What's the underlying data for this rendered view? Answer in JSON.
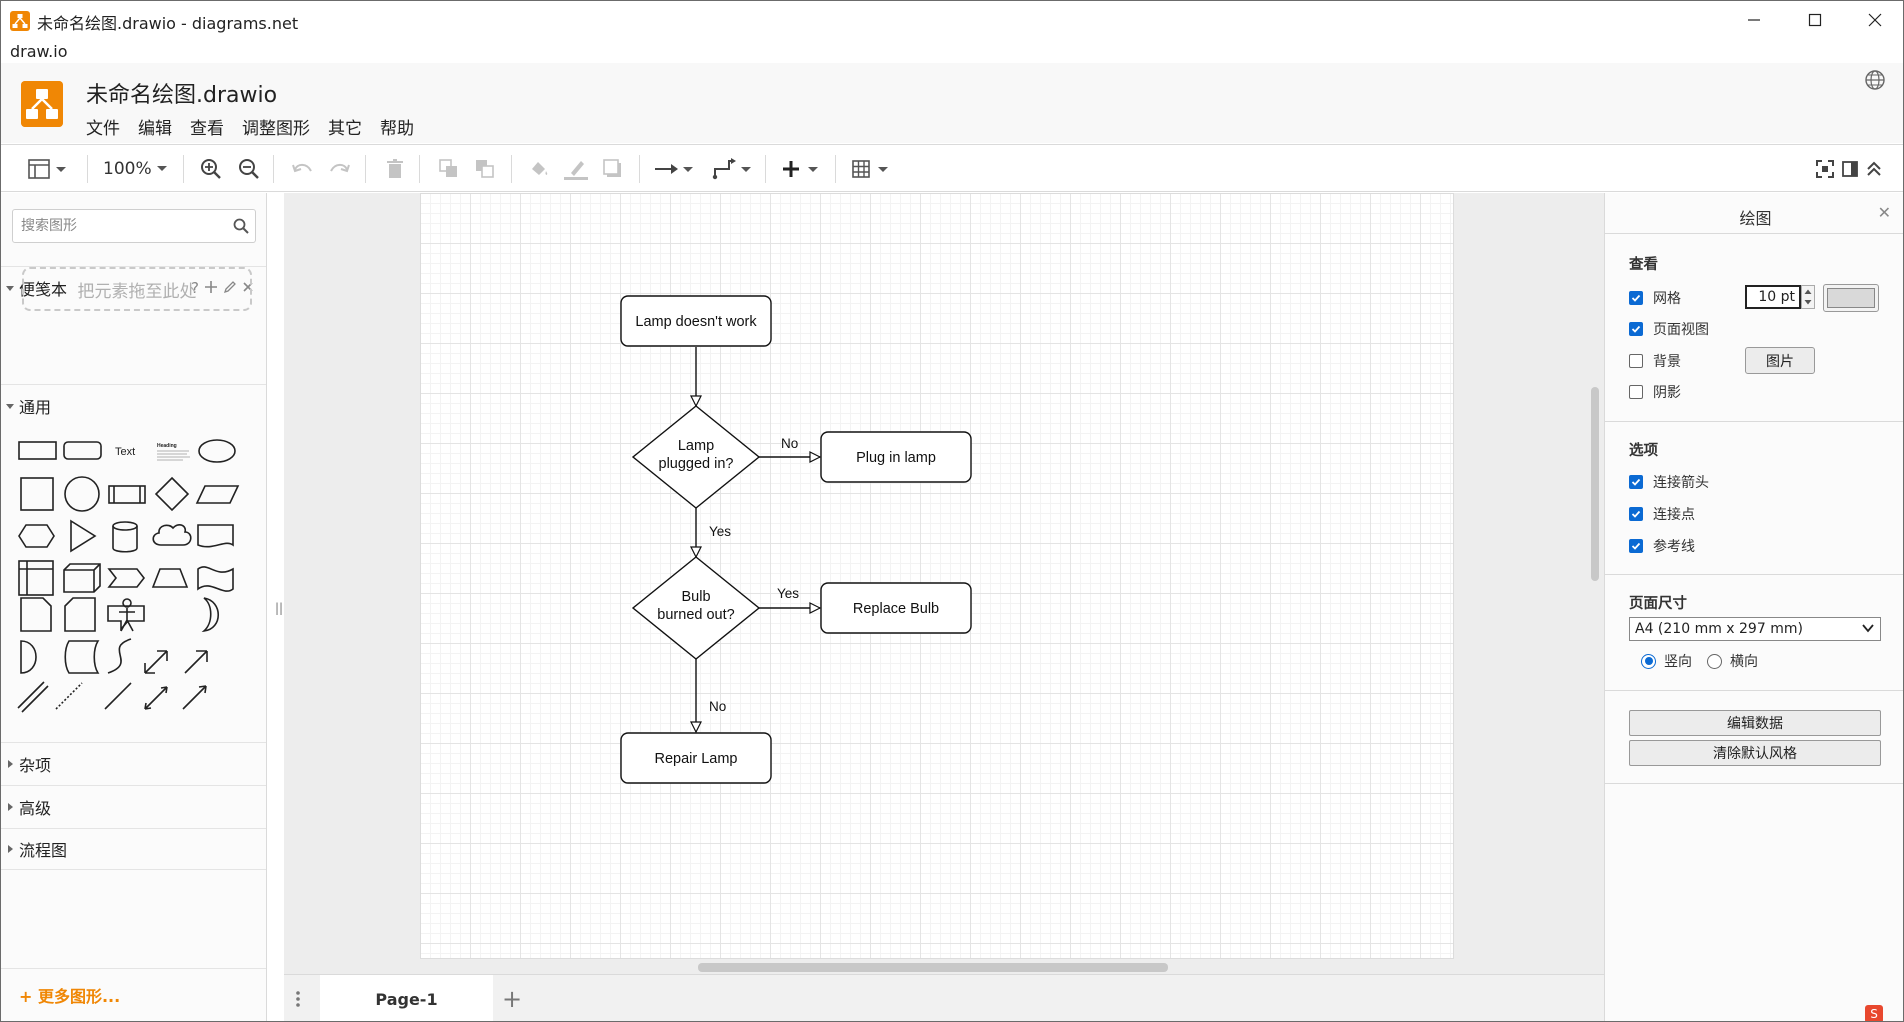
{
  "window": {
    "title": "未命名绘图.drawio - diagrams.net",
    "app_label": "draw.io"
  },
  "header": {
    "doc_title": "未命名绘图.drawio",
    "menu": [
      "文件",
      "编辑",
      "查看",
      "调整图形",
      "其它",
      "帮助"
    ]
  },
  "toolbar": {
    "zoom": "100%"
  },
  "sidebar": {
    "search_placeholder": "搜索图形",
    "scratchpad": {
      "label": "便笺本",
      "help": "?",
      "dropzone": "把元素拖至此处"
    },
    "general": {
      "label": "通用",
      "text_shape": "Text",
      "heading_shape": "Heading"
    },
    "sections": [
      "杂项",
      "高级",
      "流程图"
    ],
    "more_shapes": "+ 更多图形..."
  },
  "diagram": {
    "nodes": {
      "start": "Lamp doesn't work",
      "decision1_line1": "Lamp",
      "decision1_line2": "plugged in?",
      "plug": "Plug in lamp",
      "decision2_line1": "Bulb",
      "decision2_line2": "burned out?",
      "replace": "Replace Bulb",
      "repair": "Repair Lamp"
    },
    "edges": {
      "d1_no": "No",
      "d1_yes": "Yes",
      "d2_yes": "Yes",
      "d2_no": "No"
    }
  },
  "page_tabs": {
    "active": "Page-1",
    "add": "+"
  },
  "panel": {
    "title": "绘图",
    "close": "✕",
    "view_heading": "查看",
    "grid": {
      "label": "网格",
      "checked": true,
      "size": "10 pt"
    },
    "page_view": {
      "label": "页面视图",
      "checked": true
    },
    "background": {
      "label": "背景",
      "checked": false,
      "button": "图片"
    },
    "shadow": {
      "label": "阴影",
      "checked": false
    },
    "options_heading": "选项",
    "connection_arrows": {
      "label": "连接箭头",
      "checked": true
    },
    "connection_points": {
      "label": "连接点",
      "checked": true
    },
    "guides": {
      "label": "参考线",
      "checked": true
    },
    "page_size_heading": "页面尺寸",
    "page_size": "A4 (210 mm x 297 mm)",
    "portrait": {
      "label": "竖向",
      "selected": true
    },
    "landscape": {
      "label": "横向",
      "selected": false
    },
    "edit_data": "编辑数据",
    "clear_style": "清除默认风格"
  },
  "colors": {
    "accent": "#f08705",
    "check": "#0b6ad3"
  }
}
